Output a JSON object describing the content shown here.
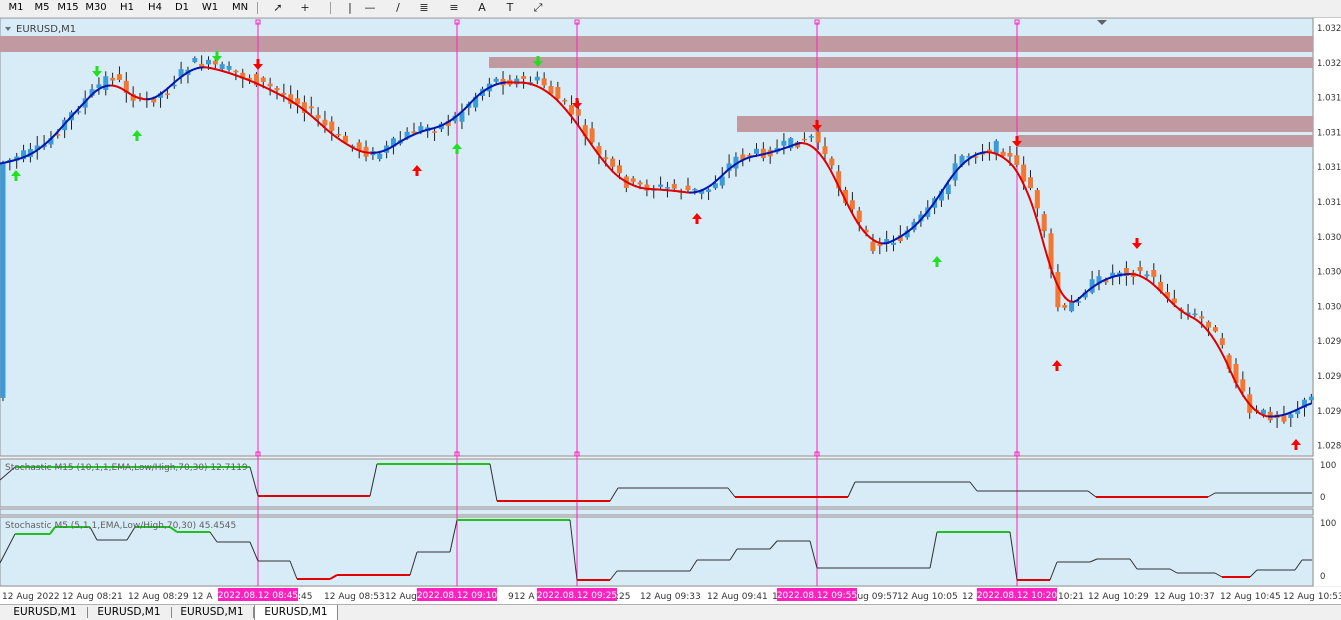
{
  "toolbar": {
    "timeframes": [
      "M1",
      "M5",
      "M15",
      "M30",
      "H1",
      "H4",
      "D1",
      "W1",
      "MN"
    ],
    "tools": [
      {
        "icon": "cursor-arrow-icon",
        "glyph": "➚"
      },
      {
        "icon": "crosshair-icon",
        "glyph": "+"
      },
      {
        "icon": "vertical-line-icon",
        "glyph": "|"
      },
      {
        "icon": "horizontal-line-icon",
        "glyph": "—"
      },
      {
        "icon": "trendline-icon",
        "glyph": "/"
      },
      {
        "icon": "fibonacci-equidistant-icon",
        "glyph": "≣"
      },
      {
        "icon": "fibonacci-icon",
        "glyph": "≡"
      },
      {
        "icon": "text-icon",
        "glyph": "A"
      },
      {
        "icon": "text-label-icon",
        "glyph": "T"
      },
      {
        "icon": "shapes-dropdown-icon",
        "glyph": "⤢"
      }
    ]
  },
  "chart": {
    "symbol_label": "EURUSD,M1",
    "price_labels": [
      "1.032",
      "1.032",
      "1.031",
      "1.031",
      "1.031",
      "1.031",
      "1.030",
      "1.030",
      "1.030",
      "1.029",
      "1.029",
      "1.029",
      "1.028"
    ],
    "colors": {
      "background": "#d8ecf8",
      "bull": "#3b9bd8",
      "bear": "#f07832",
      "ma_up": "#0018b0",
      "ma_down": "#e00000",
      "zone": "#c09aa0",
      "vline": "#ff20c0",
      "arrow_up_green": "#20e020",
      "arrow_down_red": "#ff0000"
    },
    "indicator1_label": "Stochastic M15 (10,1,1,EMA,Low/High,70,30) 12.7119",
    "indicator2_label": "Stochastic M5 (5,1,1,EMA,Low/High,70,30) 45.4545",
    "indicator1_levels": [
      "100",
      "0"
    ],
    "indicator2_levels": [
      "100",
      "0"
    ],
    "time_labels": [
      "12 Aug 2022",
      "12 Aug 08:21",
      "12 Aug 08:29",
      "12 Aug 08:37",
      "12 Aug 08:45",
      "12 Aug 08:53",
      "12 Aug 09:01",
      "12 Aug 09:09",
      "12 Aug 09:17",
      "12 Aug 09:25",
      "12 Aug 09:33",
      "12 Aug 09:41",
      "12 Aug 09:49",
      "12 Aug 09:57",
      "12 Aug 10:05",
      "12 Aug 10:13",
      "12 Aug 10:21",
      "12 Aug 10:29",
      "12 Aug 10:37",
      "12 Aug 10:45",
      "12 Aug 10:53"
    ],
    "time_label_texts": [
      "12 Aug 2022",
      "12 Aug 08:21",
      "12 Aug 08:29",
      "12 A",
      ":45",
      "12 Aug 08:53",
      "12 Aug",
      "9",
      "12 A",
      ":25",
      "12 Aug 09:33",
      "12 Aug 09:41",
      "12 Aug 09:49",
      "12 Aug 09:57",
      "12 Aug 10:05",
      "12 A",
      "10:21",
      "12 Aug 10:29",
      "12 Aug 10:37",
      "12 Aug 10:45",
      "12 Aug 10:53"
    ],
    "vline_labels": [
      "2022.08.12 08:45",
      "2022.08.12 09:10",
      "2022.08.12 09:25",
      "2022.08.12 09:55",
      "2022.08.12 10:20"
    ]
  },
  "tabs": [
    {
      "label": "EURUSD,M1",
      "active": false
    },
    {
      "label": "EURUSD,M1",
      "active": false
    },
    {
      "label": "EURUSD,M1",
      "active": false
    },
    {
      "label": "EURUSD,M1",
      "active": true
    }
  ]
}
